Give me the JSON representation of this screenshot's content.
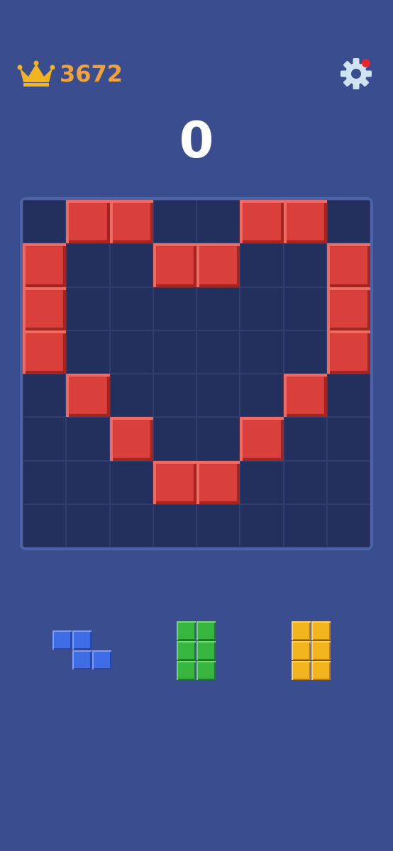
{
  "header": {
    "best_score": "3672",
    "current_score": "0",
    "crown_icon": "crown-icon",
    "settings_icon": "gear-icon",
    "notification_color": "#e8252c"
  },
  "board": {
    "rows": 8,
    "cols": 8,
    "filled_color": "#d63a36",
    "cells": [
      [
        0,
        1,
        1,
        0,
        0,
        1,
        1,
        0
      ],
      [
        1,
        0,
        0,
        1,
        1,
        0,
        0,
        1
      ],
      [
        1,
        0,
        0,
        0,
        0,
        0,
        0,
        1
      ],
      [
        1,
        0,
        0,
        0,
        0,
        0,
        0,
        1
      ],
      [
        0,
        1,
        0,
        0,
        0,
        0,
        1,
        0
      ],
      [
        0,
        0,
        1,
        0,
        0,
        1,
        0,
        0
      ],
      [
        0,
        0,
        0,
        1,
        1,
        0,
        0,
        0
      ],
      [
        0,
        0,
        0,
        0,
        0,
        0,
        0,
        0
      ]
    ]
  },
  "pieces": [
    {
      "name": "blue-z-piece",
      "color": "blue",
      "shape": [
        [
          1,
          1,
          0
        ],
        [
          0,
          1,
          1
        ]
      ]
    },
    {
      "name": "green-2x3-piece",
      "color": "green",
      "shape": [
        [
          1,
          1
        ],
        [
          1,
          1
        ],
        [
          1,
          1
        ]
      ]
    },
    {
      "name": "yellow-2x3-piece",
      "color": "yellow",
      "shape": [
        [
          1,
          1
        ],
        [
          1,
          1
        ],
        [
          1,
          1
        ]
      ]
    }
  ]
}
